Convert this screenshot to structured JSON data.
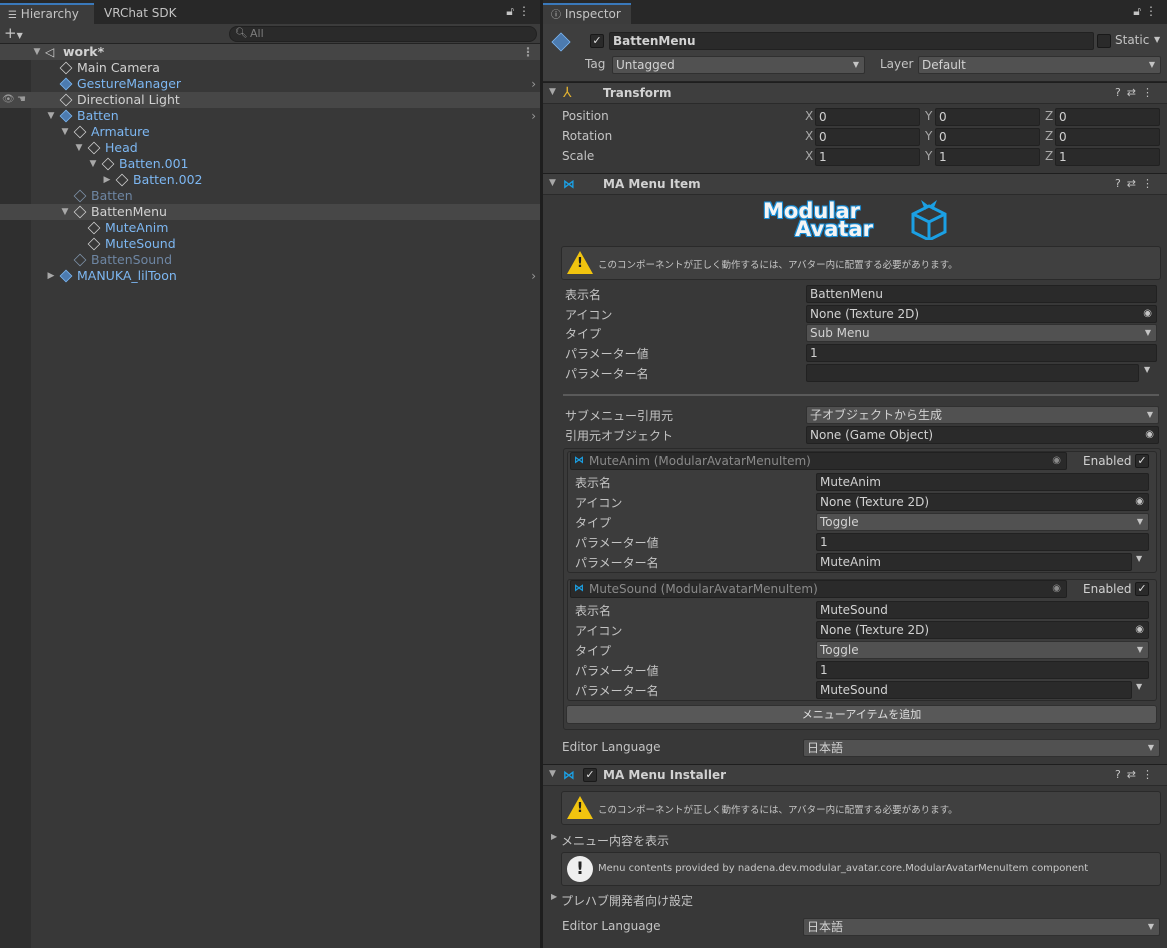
{
  "hierarchy": {
    "tabs": [
      "Hierarchy",
      "VRChat SDK"
    ],
    "search_placeholder": "All",
    "scene": "work*",
    "items": [
      {
        "label": "Main Camera",
        "color": "white"
      },
      {
        "label": "GestureManager",
        "color": "blue"
      },
      {
        "label": "Directional Light",
        "color": "white"
      },
      {
        "label": "Batten",
        "color": "blue"
      },
      {
        "label": "Armature",
        "color": "blue"
      },
      {
        "label": "Head",
        "color": "blue"
      },
      {
        "label": "Batten.001",
        "color": "blue"
      },
      {
        "label": "Batten.002",
        "color": "blue"
      },
      {
        "label": "Batten",
        "color": "dim"
      },
      {
        "label": "BattenMenu",
        "color": "white"
      },
      {
        "label": "MuteAnim",
        "color": "blue"
      },
      {
        "label": "MuteSound",
        "color": "blue"
      },
      {
        "label": "BattenSound",
        "color": "dim"
      },
      {
        "label": "MANUKA_lilToon",
        "color": "blue"
      }
    ]
  },
  "inspector": {
    "tab": "Inspector",
    "object_name": "BattenMenu",
    "static_label": "Static",
    "tag_label": "Tag",
    "tag_value": "Untagged",
    "layer_label": "Layer",
    "layer_value": "Default",
    "transform": {
      "title": "Transform",
      "rows": [
        {
          "label": "Position",
          "x": "0",
          "y": "0",
          "z": "0"
        },
        {
          "label": "Rotation",
          "x": "0",
          "y": "0",
          "z": "0"
        },
        {
          "label": "Scale",
          "x": "1",
          "y": "1",
          "z": "1"
        }
      ],
      "axis": [
        "X",
        "Y",
        "Z"
      ]
    },
    "menu_item": {
      "title": "MA Menu Item",
      "logo_line1": "Modular",
      "logo_line2": "Avatar",
      "warning": "このコンポーネントが正しく動作するには、アバター内に配置する必要があります。",
      "fields": [
        {
          "label": "表示名",
          "value": "BattenMenu"
        },
        {
          "label": "アイコン",
          "value": "None (Texture 2D)"
        },
        {
          "label": "タイプ",
          "value": "Sub Menu"
        },
        {
          "label": "パラメーター値",
          "value": "1"
        },
        {
          "label": "パラメーター名",
          "value": ""
        }
      ],
      "submenu_source_label": "サブメニュー引用元",
      "submenu_source_value": "子オブジェクトから生成",
      "source_object_label": "引用元オブジェクト",
      "source_object_value": "None (Game Object)",
      "children": [
        {
          "header": "MuteAnim (ModularAvatarMenuItem)",
          "enabled": "Enabled",
          "fields": [
            {
              "label": "表示名",
              "value": "MuteAnim"
            },
            {
              "label": "アイコン",
              "value": "None (Texture 2D)"
            },
            {
              "label": "タイプ",
              "value": "Toggle"
            },
            {
              "label": "パラメーター値",
              "value": "1"
            },
            {
              "label": "パラメーター名",
              "value": "MuteAnim"
            }
          ]
        },
        {
          "header": "MuteSound (ModularAvatarMenuItem)",
          "enabled": "Enabled",
          "fields": [
            {
              "label": "表示名",
              "value": "MuteSound"
            },
            {
              "label": "アイコン",
              "value": "None (Texture 2D)"
            },
            {
              "label": "タイプ",
              "value": "Toggle"
            },
            {
              "label": "パラメーター値",
              "value": "1"
            },
            {
              "label": "パラメーター名",
              "value": "MuteSound"
            }
          ]
        }
      ],
      "add_button": "メニューアイテムを追加",
      "editor_language_label": "Editor Language",
      "editor_language_value": "日本語"
    },
    "installer": {
      "title": "MA Menu Installer",
      "warning": "このコンポーネントが正しく動作するには、アバター内に配置する必要があります。",
      "show_contents": "メニュー内容を表示",
      "info": "Menu contents provided by nadena.dev.modular_avatar.core.ModularAvatarMenuItem component",
      "prefab_settings": "プレハブ開発者向け設定",
      "editor_language_label": "Editor Language",
      "editor_language_value": "日本語"
    }
  }
}
